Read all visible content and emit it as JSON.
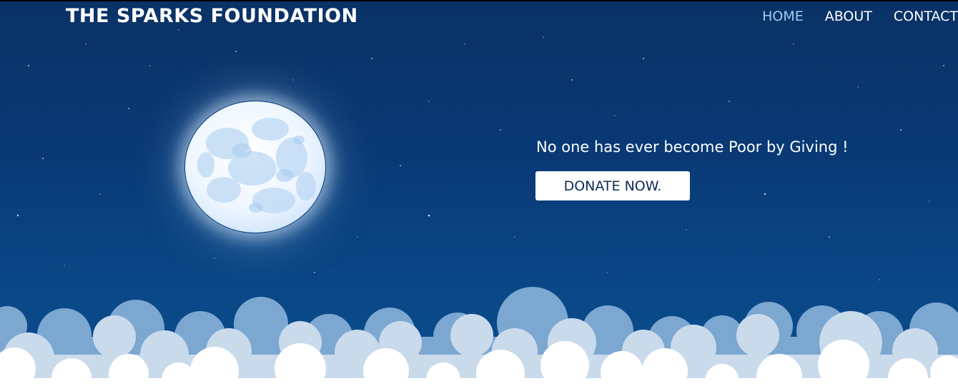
{
  "header": {
    "brand": "THE SPARKS FOUNDATION",
    "nav": [
      {
        "label": "HOME",
        "active": true
      },
      {
        "label": "ABOUT",
        "active": false
      },
      {
        "label": "CONTACT",
        "active": false
      }
    ]
  },
  "hero": {
    "tagline": "No one has ever become Poor by Giving !",
    "button_label": "DONATE NOW."
  },
  "colors": {
    "sky_top": "#0a3266",
    "sky_bottom": "#0b4f8f",
    "nav_active": "#9cd0f4",
    "button_text": "#0c2c57",
    "cloud_back": "#7ba7d1",
    "cloud_mid": "#c9daeb",
    "cloud_front": "#ffffff"
  },
  "icons": [
    "moon-icon",
    "clouds-decoration",
    "stars-decoration"
  ]
}
